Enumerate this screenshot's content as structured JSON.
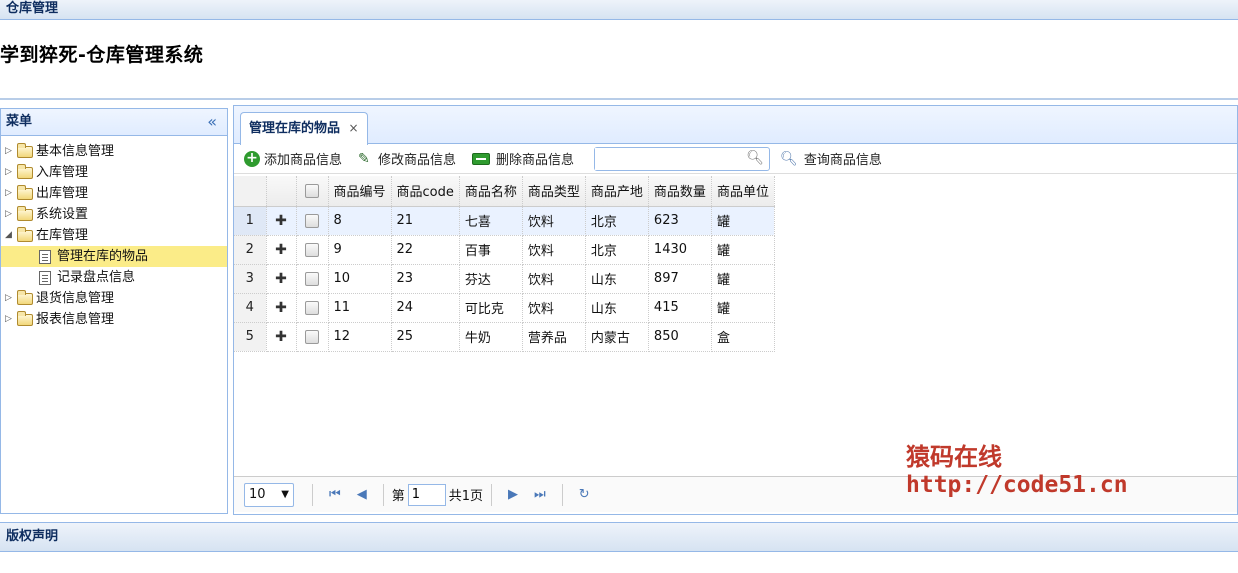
{
  "window": {
    "title": "仓库管理"
  },
  "app": {
    "title": "学到猝死-仓库管理系统"
  },
  "menu": {
    "title": "菜单",
    "collapse_icon": "«",
    "items": [
      {
        "label": "基本信息管理",
        "type": "folder",
        "state": "collapsed"
      },
      {
        "label": "入库管理",
        "type": "folder",
        "state": "collapsed"
      },
      {
        "label": "出库管理",
        "type": "folder",
        "state": "collapsed"
      },
      {
        "label": "系统设置",
        "type": "folder",
        "state": "collapsed"
      },
      {
        "label": "在库管理",
        "type": "folder",
        "state": "expanded"
      },
      {
        "label": "管理在库的物品",
        "type": "page",
        "selected": true
      },
      {
        "label": "记录盘点信息",
        "type": "page"
      },
      {
        "label": "退货信息管理",
        "type": "folder",
        "state": "collapsed"
      },
      {
        "label": "报表信息管理",
        "type": "folder",
        "state": "collapsed"
      }
    ]
  },
  "tab": {
    "label": "管理在库的物品",
    "close": "×"
  },
  "toolbar": {
    "add": "添加商品信息",
    "edit": "修改商品信息",
    "delete": "删除商品信息",
    "search_value": "",
    "query": "查询商品信息"
  },
  "grid": {
    "headers": [
      "商品编号",
      "商品code",
      "商品名称",
      "商品类型",
      "商品产地",
      "商品数量",
      "商品单位"
    ],
    "rows": [
      {
        "n": "1",
        "cells": [
          "8",
          "21",
          "七喜",
          "饮料",
          "北京",
          "623",
          "罐"
        ]
      },
      {
        "n": "2",
        "cells": [
          "9",
          "22",
          "百事",
          "饮料",
          "北京",
          "1430",
          "罐"
        ]
      },
      {
        "n": "3",
        "cells": [
          "10",
          "23",
          "芬达",
          "饮料",
          "山东",
          "897",
          "罐"
        ]
      },
      {
        "n": "4",
        "cells": [
          "11",
          "24",
          "可比克",
          "饮料",
          "山东",
          "415",
          "罐"
        ]
      },
      {
        "n": "5",
        "cells": [
          "12",
          "25",
          "牛奶",
          "营养品",
          "内蒙古",
          "850",
          "盒"
        ]
      }
    ]
  },
  "pager": {
    "page_size": "10",
    "page_prefix": "第",
    "page_value": "1",
    "page_suffix": "共1页"
  },
  "watermark": {
    "line1": "猿码在线",
    "line2": "http://code51.cn"
  },
  "footer": {
    "title": "版权声明"
  }
}
